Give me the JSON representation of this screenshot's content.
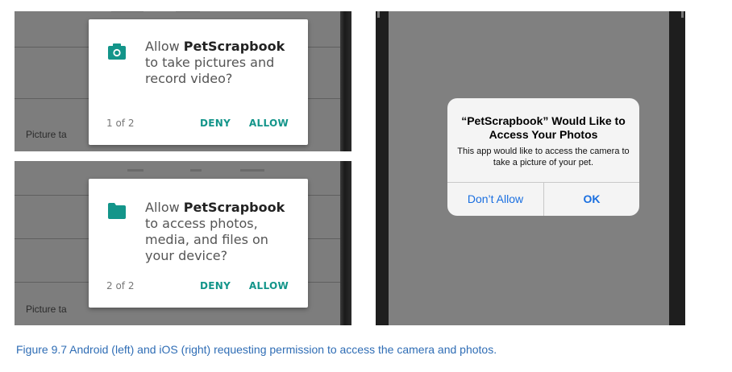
{
  "android_top": {
    "icon": "camera-icon",
    "msg_prefix": "Allow ",
    "app_name": "PetScrapbook",
    "msg_suffix": " to take pictures and record video?",
    "counter": "1 of 2",
    "deny": "DENY",
    "allow": "ALLOW",
    "bg_text": "Picture ta"
  },
  "android_bottom": {
    "icon": "folder-icon",
    "msg_prefix": "Allow ",
    "app_name": "PetScrapbook",
    "msg_suffix": " to access photos, media, and files on your device?",
    "counter": "2 of 2",
    "deny": "DENY",
    "allow": "ALLOW",
    "bg_text": "Picture ta"
  },
  "ios": {
    "title": "“PetScrapbook” Would Like to Access Your Photos",
    "body": "This app would like to access the camera to take a picture of your pet.",
    "dont_allow": "Don’t Allow",
    "ok": "OK"
  },
  "caption": "Figure 9.7 Android (left) and iOS (right) requesting permission to access the camera and photos.",
  "colors": {
    "android_accent": "#13958a",
    "ios_link": "#1a6fe0",
    "caption": "#2f6db5"
  }
}
